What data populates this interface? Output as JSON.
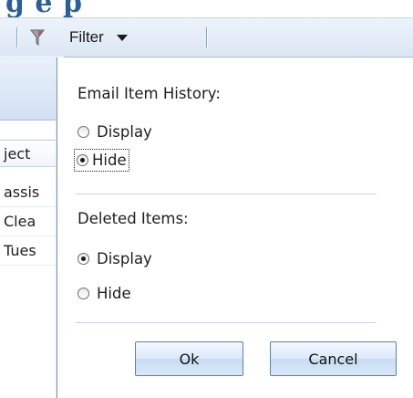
{
  "header": {
    "title_fragment": "g   e   p"
  },
  "toolbar": {
    "filter_label": "Filter",
    "filter_icon": "funnel-icon",
    "dropdown_icon": "caret-down-icon"
  },
  "grid": {
    "column_header": "ject",
    "rows": [
      "assis",
      "Clea",
      "Tues"
    ]
  },
  "dropdown": {
    "email_history": {
      "label": "Email Item History:",
      "options": [
        {
          "label": "Display",
          "checked": false
        },
        {
          "label": "Hide",
          "checked": true
        }
      ]
    },
    "deleted_items": {
      "label": "Deleted Items:",
      "options": [
        {
          "label": "Display",
          "checked": true
        },
        {
          "label": "Hide",
          "checked": false
        }
      ]
    },
    "ok_label": "Ok",
    "cancel_label": "Cancel"
  },
  "colors": {
    "accent": "#2a5f9e",
    "toolbar_bg": "#dbe6f4",
    "panel_border": "#7f95b5"
  }
}
